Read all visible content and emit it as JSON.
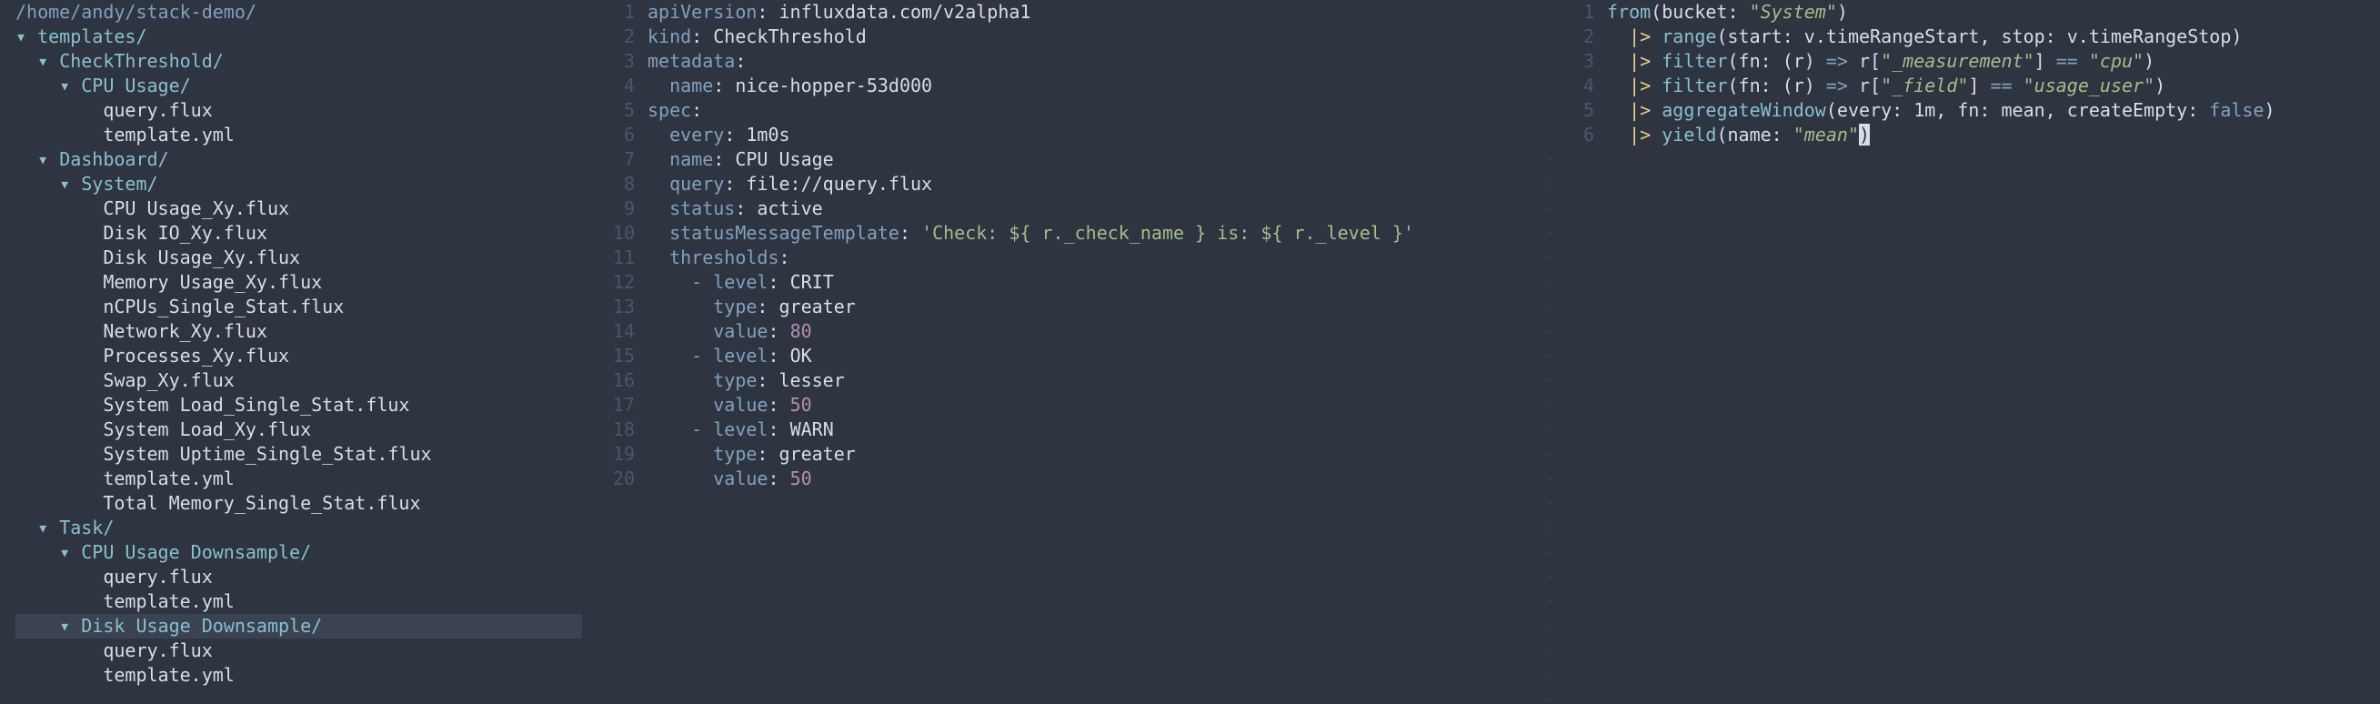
{
  "tree": {
    "root": "/home/andy/stack-demo/",
    "items": [
      {
        "indent": 0,
        "type": "dir",
        "arrow": "▾",
        "name": "templates/"
      },
      {
        "indent": 1,
        "type": "dir",
        "arrow": "▾",
        "name": "CheckThreshold/"
      },
      {
        "indent": 2,
        "type": "dir",
        "arrow": "▾",
        "name": "CPU Usage/"
      },
      {
        "indent": 3,
        "type": "file",
        "name": "query.flux"
      },
      {
        "indent": 3,
        "type": "file",
        "name": "template.yml"
      },
      {
        "indent": 1,
        "type": "dir",
        "arrow": "▾",
        "name": "Dashboard/"
      },
      {
        "indent": 2,
        "type": "dir",
        "arrow": "▾",
        "name": "System/"
      },
      {
        "indent": 3,
        "type": "file",
        "name": "CPU Usage_Xy.flux"
      },
      {
        "indent": 3,
        "type": "file",
        "name": "Disk IO_Xy.flux"
      },
      {
        "indent": 3,
        "type": "file",
        "name": "Disk Usage_Xy.flux"
      },
      {
        "indent": 3,
        "type": "file",
        "name": "Memory Usage_Xy.flux"
      },
      {
        "indent": 3,
        "type": "file",
        "name": "nCPUs_Single_Stat.flux"
      },
      {
        "indent": 3,
        "type": "file",
        "name": "Network_Xy.flux"
      },
      {
        "indent": 3,
        "type": "file",
        "name": "Processes_Xy.flux"
      },
      {
        "indent": 3,
        "type": "file",
        "name": "Swap_Xy.flux"
      },
      {
        "indent": 3,
        "type": "file",
        "name": "System Load_Single_Stat.flux"
      },
      {
        "indent": 3,
        "type": "file",
        "name": "System Load_Xy.flux"
      },
      {
        "indent": 3,
        "type": "file",
        "name": "System Uptime_Single_Stat.flux"
      },
      {
        "indent": 3,
        "type": "file",
        "name": "template.yml"
      },
      {
        "indent": 3,
        "type": "file",
        "name": "Total Memory_Single_Stat.flux"
      },
      {
        "indent": 1,
        "type": "dir",
        "arrow": "▾",
        "name": "Task/"
      },
      {
        "indent": 2,
        "type": "dir",
        "arrow": "▾",
        "name": "CPU Usage Downsample/"
      },
      {
        "indent": 3,
        "type": "file",
        "name": "query.flux"
      },
      {
        "indent": 3,
        "type": "file",
        "name": "template.yml"
      },
      {
        "indent": 2,
        "type": "dir",
        "arrow": "▾",
        "name": "Disk Usage Downsample/",
        "selected": true
      },
      {
        "indent": 3,
        "type": "file",
        "name": "query.flux"
      },
      {
        "indent": 3,
        "type": "file",
        "name": "template.yml"
      }
    ]
  },
  "yaml_lines": [
    [
      {
        "c": "k",
        "t": "apiVersion"
      },
      {
        "c": "v",
        "t": ": influxdata.com/v2alpha1"
      }
    ],
    [
      {
        "c": "k",
        "t": "kind"
      },
      {
        "c": "v",
        "t": ": CheckThreshold"
      }
    ],
    [
      {
        "c": "k",
        "t": "metadata"
      },
      {
        "c": "v",
        "t": ":"
      }
    ],
    [
      {
        "c": "v",
        "t": "  "
      },
      {
        "c": "k",
        "t": "name"
      },
      {
        "c": "v",
        "t": ": nice-hopper-53d000"
      }
    ],
    [
      {
        "c": "k",
        "t": "spec"
      },
      {
        "c": "v",
        "t": ":"
      }
    ],
    [
      {
        "c": "v",
        "t": "  "
      },
      {
        "c": "k",
        "t": "every"
      },
      {
        "c": "v",
        "t": ": 1m0s"
      }
    ],
    [
      {
        "c": "v",
        "t": "  "
      },
      {
        "c": "k",
        "t": "name"
      },
      {
        "c": "v",
        "t": ": CPU Usage"
      }
    ],
    [
      {
        "c": "v",
        "t": "  "
      },
      {
        "c": "k",
        "t": "query"
      },
      {
        "c": "v",
        "t": ": file://query.flux"
      }
    ],
    [
      {
        "c": "v",
        "t": "  "
      },
      {
        "c": "k",
        "t": "status"
      },
      {
        "c": "v",
        "t": ": active"
      }
    ],
    [
      {
        "c": "v",
        "t": "  "
      },
      {
        "c": "k",
        "t": "statusMessageTemplate"
      },
      {
        "c": "v",
        "t": ": "
      },
      {
        "c": "s",
        "t": "'Check: ${ r._check_name } is: ${ r._level }'"
      }
    ],
    [
      {
        "c": "v",
        "t": "  "
      },
      {
        "c": "k",
        "t": "thresholds"
      },
      {
        "c": "v",
        "t": ":"
      }
    ],
    [
      {
        "c": "v",
        "t": "    "
      },
      {
        "c": "k",
        "t": "- "
      },
      {
        "c": "k",
        "t": "level"
      },
      {
        "c": "v",
        "t": ": CRIT"
      }
    ],
    [
      {
        "c": "v",
        "t": "      "
      },
      {
        "c": "k",
        "t": "type"
      },
      {
        "c": "v",
        "t": ": greater"
      }
    ],
    [
      {
        "c": "v",
        "t": "      "
      },
      {
        "c": "k",
        "t": "value"
      },
      {
        "c": "v",
        "t": ": "
      },
      {
        "c": "n",
        "t": "80"
      }
    ],
    [
      {
        "c": "v",
        "t": "    "
      },
      {
        "c": "k",
        "t": "- "
      },
      {
        "c": "k",
        "t": "level"
      },
      {
        "c": "v",
        "t": ": OK"
      }
    ],
    [
      {
        "c": "v",
        "t": "      "
      },
      {
        "c": "k",
        "t": "type"
      },
      {
        "c": "v",
        "t": ": lesser"
      }
    ],
    [
      {
        "c": "v",
        "t": "      "
      },
      {
        "c": "k",
        "t": "value"
      },
      {
        "c": "v",
        "t": ": "
      },
      {
        "c": "n",
        "t": "50"
      }
    ],
    [
      {
        "c": "v",
        "t": "    "
      },
      {
        "c": "k",
        "t": "- "
      },
      {
        "c": "k",
        "t": "level"
      },
      {
        "c": "v",
        "t": ": WARN"
      }
    ],
    [
      {
        "c": "v",
        "t": "      "
      },
      {
        "c": "k",
        "t": "type"
      },
      {
        "c": "v",
        "t": ": greater"
      }
    ],
    [
      {
        "c": "v",
        "t": "      "
      },
      {
        "c": "k",
        "t": "value"
      },
      {
        "c": "v",
        "t": ": "
      },
      {
        "c": "n",
        "t": "50"
      }
    ]
  ],
  "flux_lines": [
    [
      {
        "c": "f",
        "t": "from"
      },
      {
        "c": "v",
        "t": "(bucket: "
      },
      {
        "c": "i",
        "t": "\"System\""
      },
      {
        "c": "v",
        "t": ")"
      }
    ],
    [
      {
        "c": "v",
        "t": "  "
      },
      {
        "c": "p",
        "t": "|>"
      },
      {
        "c": "v",
        "t": " "
      },
      {
        "c": "f",
        "t": "range"
      },
      {
        "c": "v",
        "t": "(start: v.timeRangeStart, stop: v.timeRangeStop)"
      }
    ],
    [
      {
        "c": "v",
        "t": "  "
      },
      {
        "c": "p",
        "t": "|>"
      },
      {
        "c": "v",
        "t": " "
      },
      {
        "c": "f",
        "t": "filter"
      },
      {
        "c": "v",
        "t": "(fn: (r) "
      },
      {
        "c": "k",
        "t": "=>"
      },
      {
        "c": "v",
        "t": " r["
      },
      {
        "c": "i",
        "t": "\"_measurement\""
      },
      {
        "c": "v",
        "t": "] "
      },
      {
        "c": "k",
        "t": "=="
      },
      {
        "c": "v",
        "t": " "
      },
      {
        "c": "i",
        "t": "\"cpu\""
      },
      {
        "c": "v",
        "t": ")"
      }
    ],
    [
      {
        "c": "v",
        "t": "  "
      },
      {
        "c": "p",
        "t": "|>"
      },
      {
        "c": "v",
        "t": " "
      },
      {
        "c": "f",
        "t": "filter"
      },
      {
        "c": "v",
        "t": "(fn: (r) "
      },
      {
        "c": "k",
        "t": "=>"
      },
      {
        "c": "v",
        "t": " r["
      },
      {
        "c": "i",
        "t": "\"_field\""
      },
      {
        "c": "v",
        "t": "] "
      },
      {
        "c": "k",
        "t": "=="
      },
      {
        "c": "v",
        "t": " "
      },
      {
        "c": "i",
        "t": "\"usage_user\""
      },
      {
        "c": "v",
        "t": ")"
      }
    ],
    [
      {
        "c": "v",
        "t": "  "
      },
      {
        "c": "p",
        "t": "|>"
      },
      {
        "c": "v",
        "t": " "
      },
      {
        "c": "f",
        "t": "aggregateWindow"
      },
      {
        "c": "v",
        "t": "(every: 1m, fn: mean, createEmpty: "
      },
      {
        "c": "b",
        "t": "false"
      },
      {
        "c": "v",
        "t": ")"
      }
    ],
    [
      {
        "c": "v",
        "t": "  "
      },
      {
        "c": "p",
        "t": "|>"
      },
      {
        "c": "v",
        "t": " "
      },
      {
        "c": "f",
        "t": "yield"
      },
      {
        "c": "v",
        "t": "(name: "
      },
      {
        "c": "i",
        "t": "\"mean\""
      },
      {
        "c": "cursor",
        "t": ")"
      }
    ]
  ],
  "tilde_glyph": "~",
  "colors": {
    "background": "#2e3440",
    "selection": "#3b4252",
    "dir": "#88c0d0",
    "keyword": "#81a1c1",
    "string": "#a3be8c",
    "number": "#b48ead",
    "pipe": "#ebcb8b"
  }
}
